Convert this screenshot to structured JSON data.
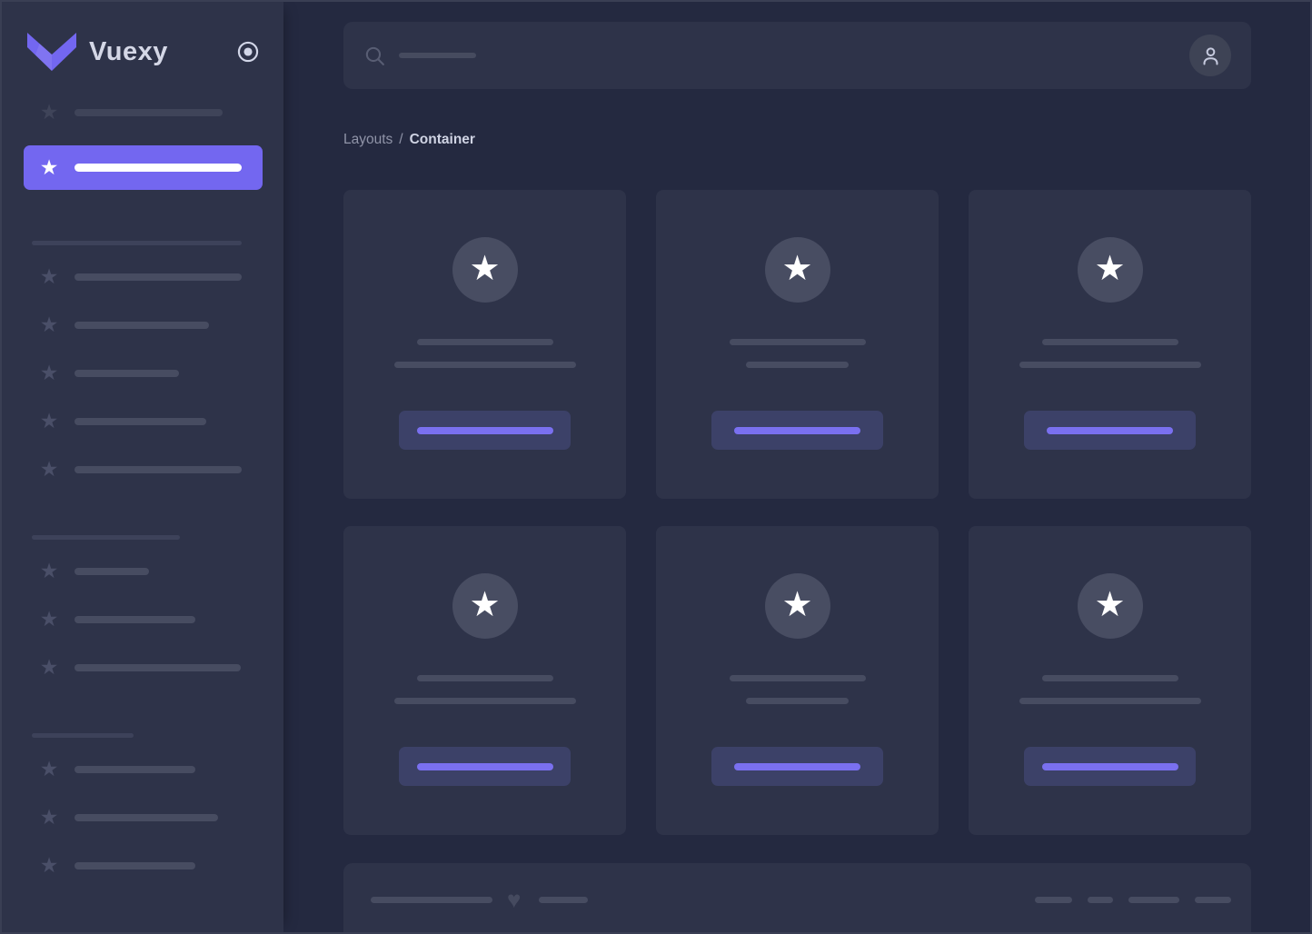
{
  "colors": {
    "accent": "#7367f0",
    "app_background": "#242940",
    "panel_background": "#2e3349",
    "skeleton_line": "#474c61",
    "button_background": "#3c4168",
    "button_line": "#7a70f0",
    "active_item": "#7367f0"
  },
  "icons": {
    "star": "★",
    "heart": "♥"
  },
  "sidebar": {
    "logo_text": "Vuexy",
    "toggle_icon": "radio-dot-icon",
    "pre_items": [
      {
        "icon": "star-icon",
        "line_width": 163,
        "dim": true
      }
    ],
    "active_item": {
      "icon": "star-icon",
      "line_width": 184
    },
    "groups": [
      {
        "header_line_width": 231,
        "item_line_widths": [
          184,
          148,
          115,
          145,
          184
        ]
      },
      {
        "header_line_width": 163,
        "item_line_widths": [
          82,
          133,
          183
        ]
      },
      {
        "header_line_width": 112,
        "item_line_widths": [
          133,
          158,
          133
        ]
      }
    ]
  },
  "header": {
    "search_icon": "search-icon",
    "search_placeholder_line_width": 85,
    "avatar_icon": "user-icon"
  },
  "breadcrumb": {
    "parent": "Layouts",
    "separator": "/",
    "current": "Container"
  },
  "cards": {
    "icon": "star-icon",
    "items": [
      {
        "line1_width": 150,
        "line2_width": 200,
        "button_line_width": 150
      },
      {
        "line1_width": 150,
        "line2_width": 113,
        "button_line_width": 139
      },
      {
        "line1_width": 150,
        "line2_width": 200,
        "button_line_width": 139
      },
      {
        "line1_width": 150,
        "line2_width": 200,
        "button_line_width": 150
      },
      {
        "line1_width": 150,
        "line2_width": 113,
        "button_line_width": 139
      },
      {
        "line1_width": 150,
        "line2_width": 200,
        "button_line_width": 150
      }
    ]
  },
  "footer": {
    "left_line_widths": [
      134,
      54
    ],
    "heart_icon": "heart-icon",
    "right_line_widths": [
      41,
      28,
      56,
      40
    ]
  }
}
